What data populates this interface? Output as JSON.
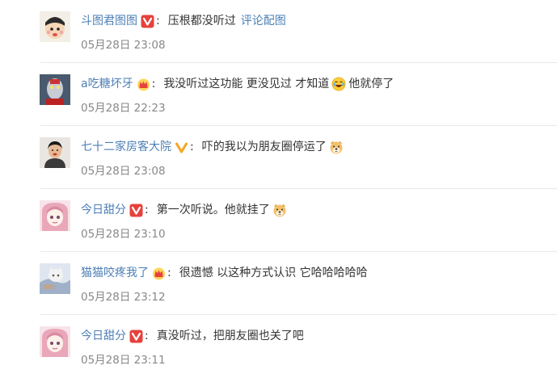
{
  "comments": [
    {
      "username": "斗图君图图",
      "badge": "v-red",
      "colon": ":",
      "text": "压根都没听过",
      "link": "评论配图",
      "time": "05月28日 23:08"
    },
    {
      "username": "a吃糖坏牙",
      "badge": "crown-red",
      "colon": ":",
      "text": "我没听过这功能 更没见过 才知道",
      "text_after": "他就停了",
      "emoji": "laughing-tears-emoji",
      "time": "05月28日 22:23"
    },
    {
      "username": "七十二家房客大院",
      "badge": "v-gold",
      "colon": ":",
      "text": "吓的我以为朋友圈停运了",
      "emoji": "doge-emoji",
      "time": "05月28日 23:08"
    },
    {
      "username": "今日甜分",
      "badge": "v-red",
      "colon": ":",
      "text": "第一次听说。他就挂了",
      "emoji": "doge-emoji",
      "time": "05月28日 23:10"
    },
    {
      "username": "猫猫咬疼我了",
      "badge": "crown-red",
      "colon": ":",
      "text": "很遗憾 以这种方式认识 它哈哈哈哈哈",
      "time": "05月28日 23:12"
    },
    {
      "username": "今日甜分",
      "badge": "v-red",
      "colon": ":",
      "text": "真没听过，把朋友圈也关了吧",
      "time": "05月28日 23:11"
    }
  ],
  "colors": {
    "username": "#4d7fb6",
    "text": "#333333",
    "time": "#888888",
    "divider": "#e9e9e9",
    "badge_red": "#e6423c",
    "badge_gold": "#f5a623"
  }
}
